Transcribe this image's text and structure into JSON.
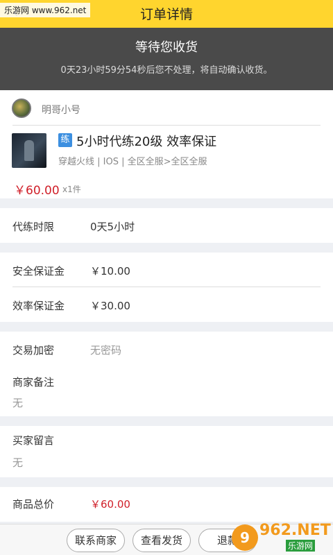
{
  "header": {
    "back_icon": "back-arrow-icon",
    "title": "订单详情",
    "site_watermark": "乐游网 www.962.net"
  },
  "status": {
    "title": "等待您收货",
    "countdown": "0天23小时59分54秒后您不处理，将自动确认收货。"
  },
  "order": {
    "shop_name": "明哥小号",
    "tag": "练",
    "product_title": "5小时代练20级 效率保证",
    "product_meta": "穿越火线 |  IOS | 全区全服>全区全服",
    "price": "￥60.00",
    "quantity": "x1件"
  },
  "details": {
    "time_limit_label": "代练时限",
    "time_limit_value": "0天5小时",
    "safety_deposit_label": "安全保证金",
    "safety_deposit_value": "￥10.00",
    "efficiency_deposit_label": "效率保证金",
    "efficiency_deposit_value": "￥30.00",
    "trade_password_label": "交易加密",
    "trade_password_value": "无密码",
    "merchant_note_label": "商家备注",
    "merchant_note_value": "无",
    "buyer_message_label": "买家留言",
    "buyer_message_value": "无",
    "total_label": "商品总价",
    "total_value": "￥60.00"
  },
  "actions": {
    "contact_label": "联系商家",
    "view_delivery_label": "查看发货",
    "refund_label": "退款"
  },
  "watermark_br": {
    "circle": "9",
    "big": "962.NET",
    "small": "乐游网"
  }
}
